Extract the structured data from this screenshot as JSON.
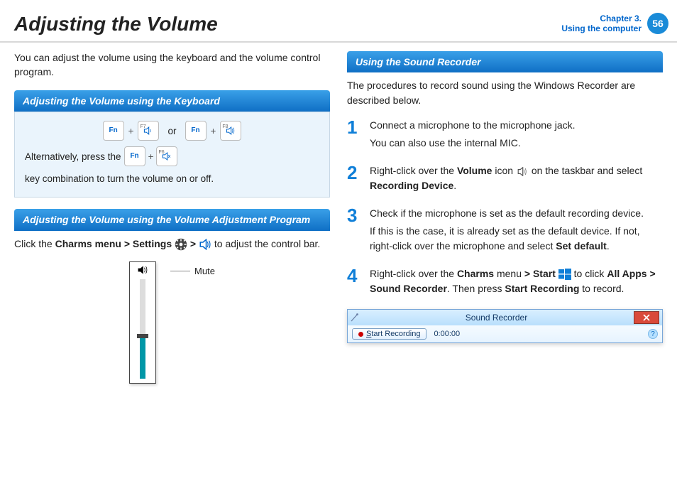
{
  "header": {
    "title": "Adjusting the Volume",
    "chapter_line1": "Chapter 3.",
    "chapter_line2": "Using the computer",
    "page": "56"
  },
  "left": {
    "intro": "You can adjust the volume using the keyboard and the volume control program.",
    "sec1": "Adjusting the Volume using the Keyboard",
    "or": "or",
    "plus": "+",
    "fn": "Fn",
    "f7": "F7",
    "f8": "F8",
    "f6": "F6",
    "alt_pre": "Alternatively, press the",
    "alt_post": "key combination to turn the volume on or off.",
    "sec2": "Adjusting the Volume using the Volume Adjustment Program",
    "charms_pre": "Click the ",
    "charms_bold": "Charms menu > Settings",
    "charms_sep": " > ",
    "charms_post": " to adjust the control bar.",
    "mute": "Mute"
  },
  "right": {
    "sec3": "Using the Sound Recorder",
    "intro": "The procedures to record sound using the Windows Recorder are described below.",
    "steps": {
      "s1": {
        "n": "1",
        "a": "Connect a microphone to the microphone jack.",
        "b": "You can also use the internal MIC."
      },
      "s2": {
        "n": "2",
        "pre": "Right-click over the ",
        "vol": "Volume",
        "mid": " icon ",
        "post": " on the taskbar and select ",
        "rd": "Recording Device",
        "dot": "."
      },
      "s3": {
        "n": "3",
        "a": "Check if the microphone is set as the default recording device.",
        "b_pre": "If this is the case, it is already set as the default device. If not, right-click over the microphone and select ",
        "b_bold": "Set default",
        "b_post": "."
      },
      "s4": {
        "n": "4",
        "pre": "Right-click over the ",
        "charms": "Charms",
        "mid1": " menu ",
        "start": "> Start",
        "mid2": " to click ",
        "allapps": "All Apps > Sound Recorder",
        "mid3": ". Then press ",
        "startrec": "Start Recording",
        "post": " to record."
      }
    },
    "recorder": {
      "title": "Sound Recorder",
      "btn": "Start Recording",
      "s_underline": "S",
      "btn_rest": "tart Recording",
      "time": "0:00:00"
    }
  }
}
